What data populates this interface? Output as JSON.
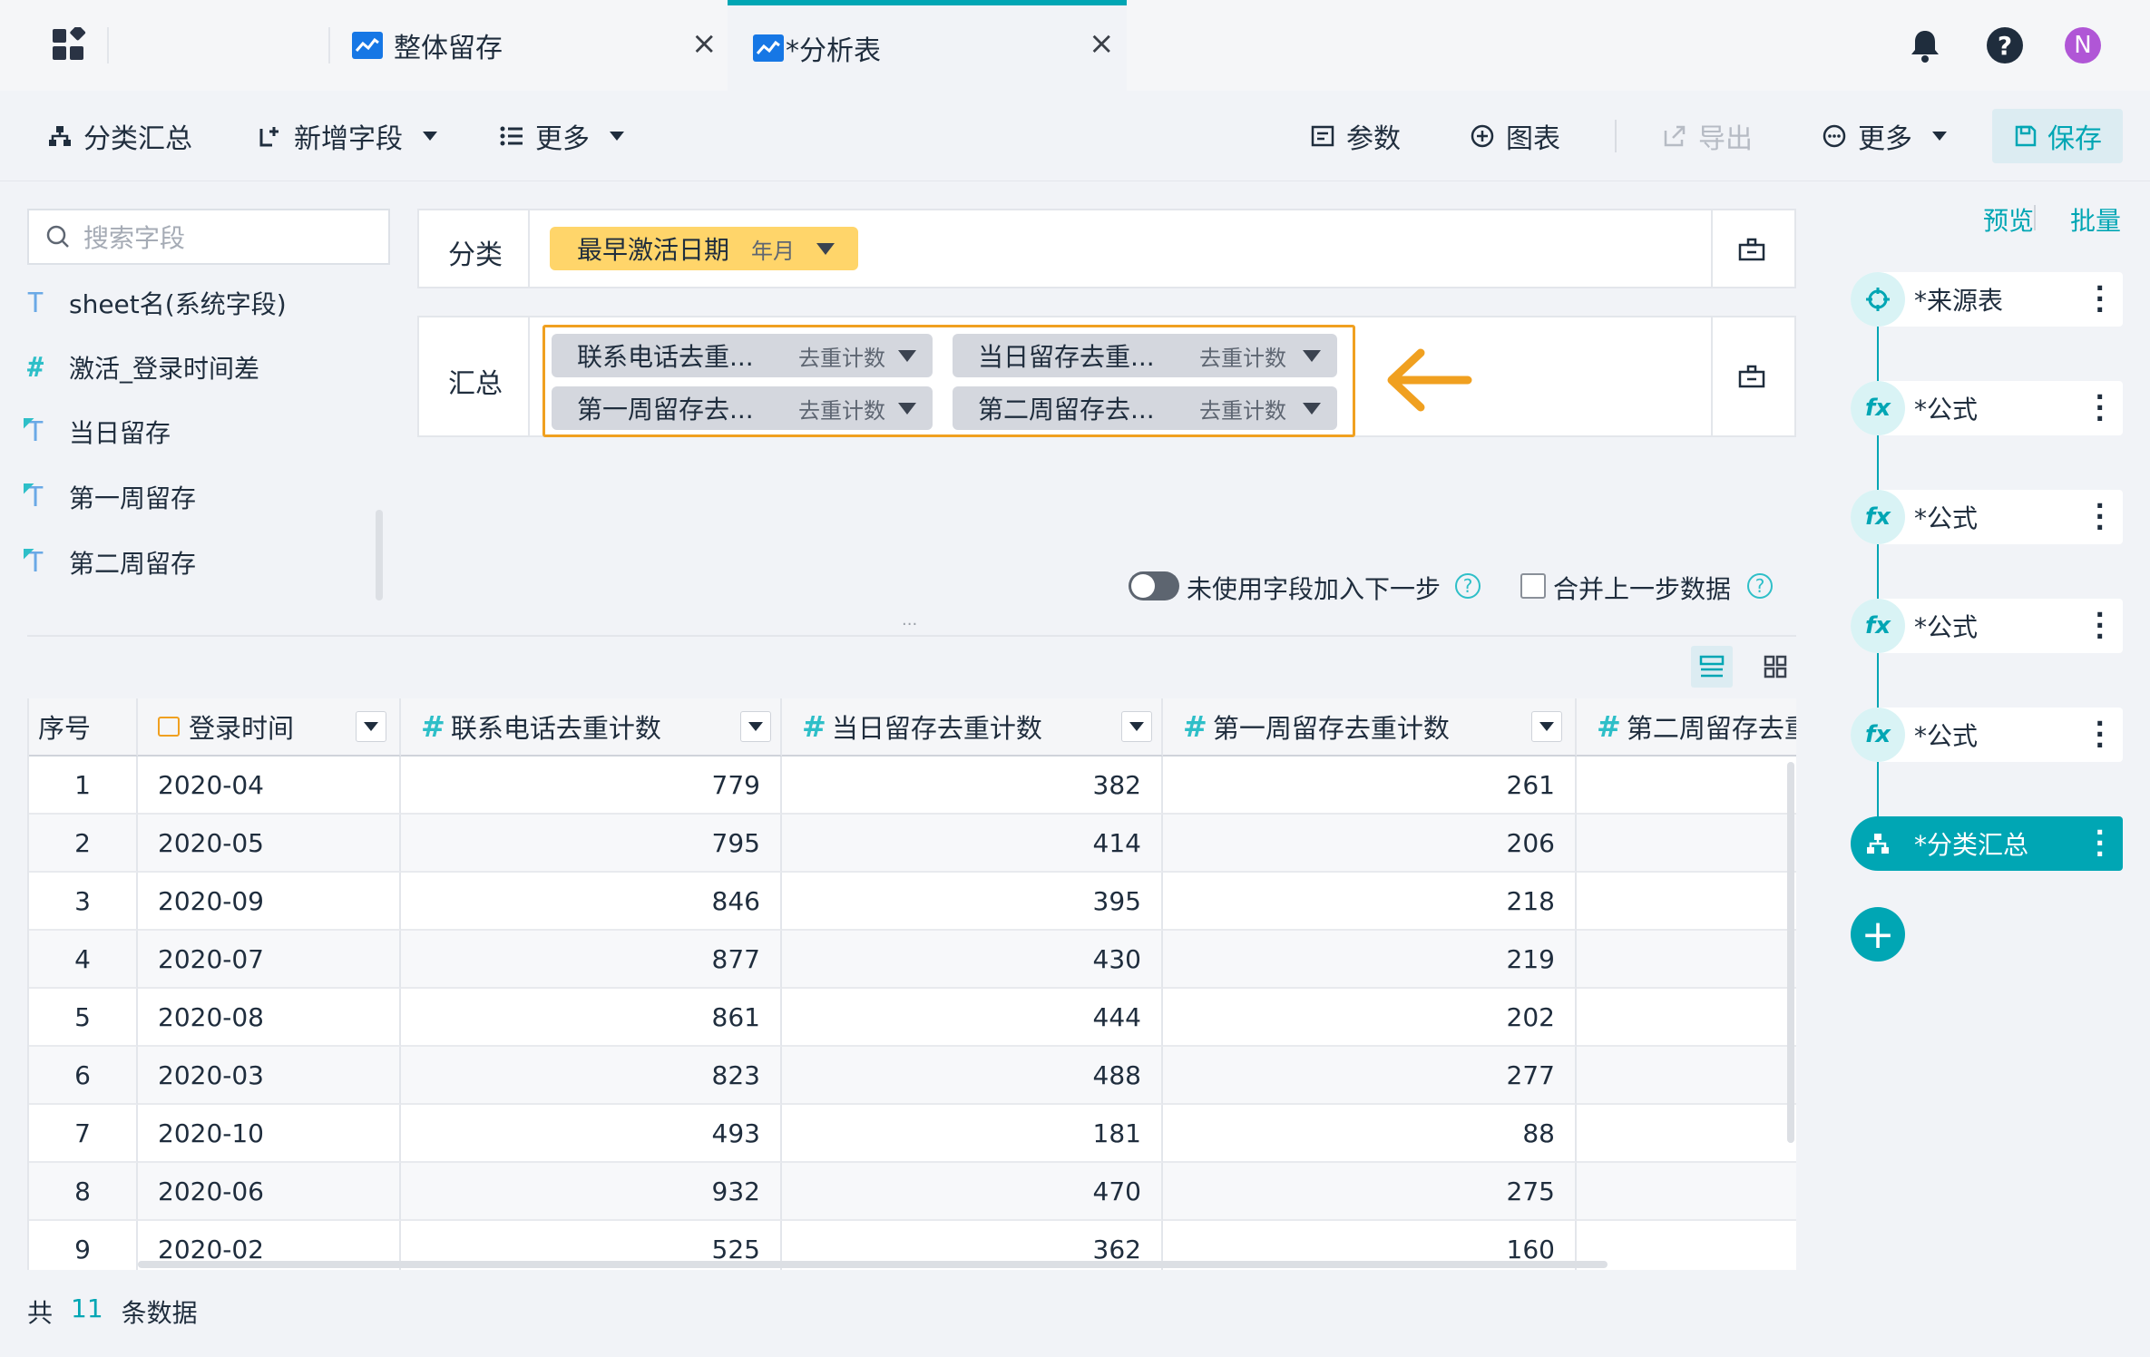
{
  "tabs": [
    {
      "label": "整体留存",
      "active": false
    },
    {
      "label": "*分析表",
      "active": true
    }
  ],
  "header": {
    "avatar_letter": "N"
  },
  "toolbar": {
    "group_summary": "分类汇总",
    "add_field": "新增字段",
    "more_left": "更多",
    "params": "参数",
    "chart": "图表",
    "export": "导出",
    "more_right": "更多",
    "save": "保存"
  },
  "sidebar": {
    "search_placeholder": "搜索字段",
    "fields": [
      {
        "type": "T",
        "label": "sheet名(系统字段)"
      },
      {
        "type": "#",
        "label": "激活_登录时间差"
      },
      {
        "type": "fT",
        "label": "当日留存"
      },
      {
        "type": "fT",
        "label": "第一周留存"
      },
      {
        "type": "fT",
        "label": "第二周留存"
      }
    ]
  },
  "config": {
    "category_label": "分类",
    "category_chip": {
      "name": "最早激活日期",
      "sub": "年月"
    },
    "summary_label": "汇总",
    "summary_chips": [
      {
        "name": "联系电话去重...",
        "sub": "去重计数"
      },
      {
        "name": "当日留存去重...",
        "sub": "去重计数"
      },
      {
        "name": "第一周留存去...",
        "sub": "去重计数"
      },
      {
        "name": "第二周留存去...",
        "sub": "去重计数"
      }
    ],
    "toggle_label": "未使用字段加入下一步",
    "merge_label": "合并上一步数据",
    "toggle_on": false,
    "merge_checked": false
  },
  "table": {
    "columns": [
      "序号",
      "登录时间",
      "联系电话去重计数",
      "当日留存去重计数",
      "第一周留存去重计数",
      "第二周留存去重"
    ],
    "rows": [
      [
        "1",
        "2020-04",
        "779",
        "382",
        "261"
      ],
      [
        "2",
        "2020-05",
        "795",
        "414",
        "206"
      ],
      [
        "3",
        "2020-09",
        "846",
        "395",
        "218"
      ],
      [
        "4",
        "2020-07",
        "877",
        "430",
        "219"
      ],
      [
        "5",
        "2020-08",
        "861",
        "444",
        "202"
      ],
      [
        "6",
        "2020-03",
        "823",
        "488",
        "277"
      ],
      [
        "7",
        "2020-10",
        "493",
        "181",
        "88"
      ],
      [
        "8",
        "2020-06",
        "932",
        "470",
        "275"
      ],
      [
        "9",
        "2020-02",
        "525",
        "362",
        "160"
      ]
    ]
  },
  "footer": {
    "prefix": "共",
    "count": "11",
    "suffix": "条数据"
  },
  "right_pane": {
    "preview": "预览",
    "batch": "批量",
    "nodes": [
      {
        "label": "*来源表",
        "icon": "source-icon",
        "active": false
      },
      {
        "label": "*公式",
        "icon": "fx-icon",
        "active": false
      },
      {
        "label": "*公式",
        "icon": "fx-icon",
        "active": false
      },
      {
        "label": "*公式",
        "icon": "fx-icon",
        "active": false
      },
      {
        "label": "*公式",
        "icon": "fx-icon",
        "active": false
      },
      {
        "label": "*分类汇总",
        "icon": "group-icon",
        "active": true
      }
    ]
  },
  "colors": {
    "accent": "#00a6b4",
    "highlight": "#f0a020",
    "chip_yellow": "#ffd56a",
    "avatar": "#b056d6"
  }
}
